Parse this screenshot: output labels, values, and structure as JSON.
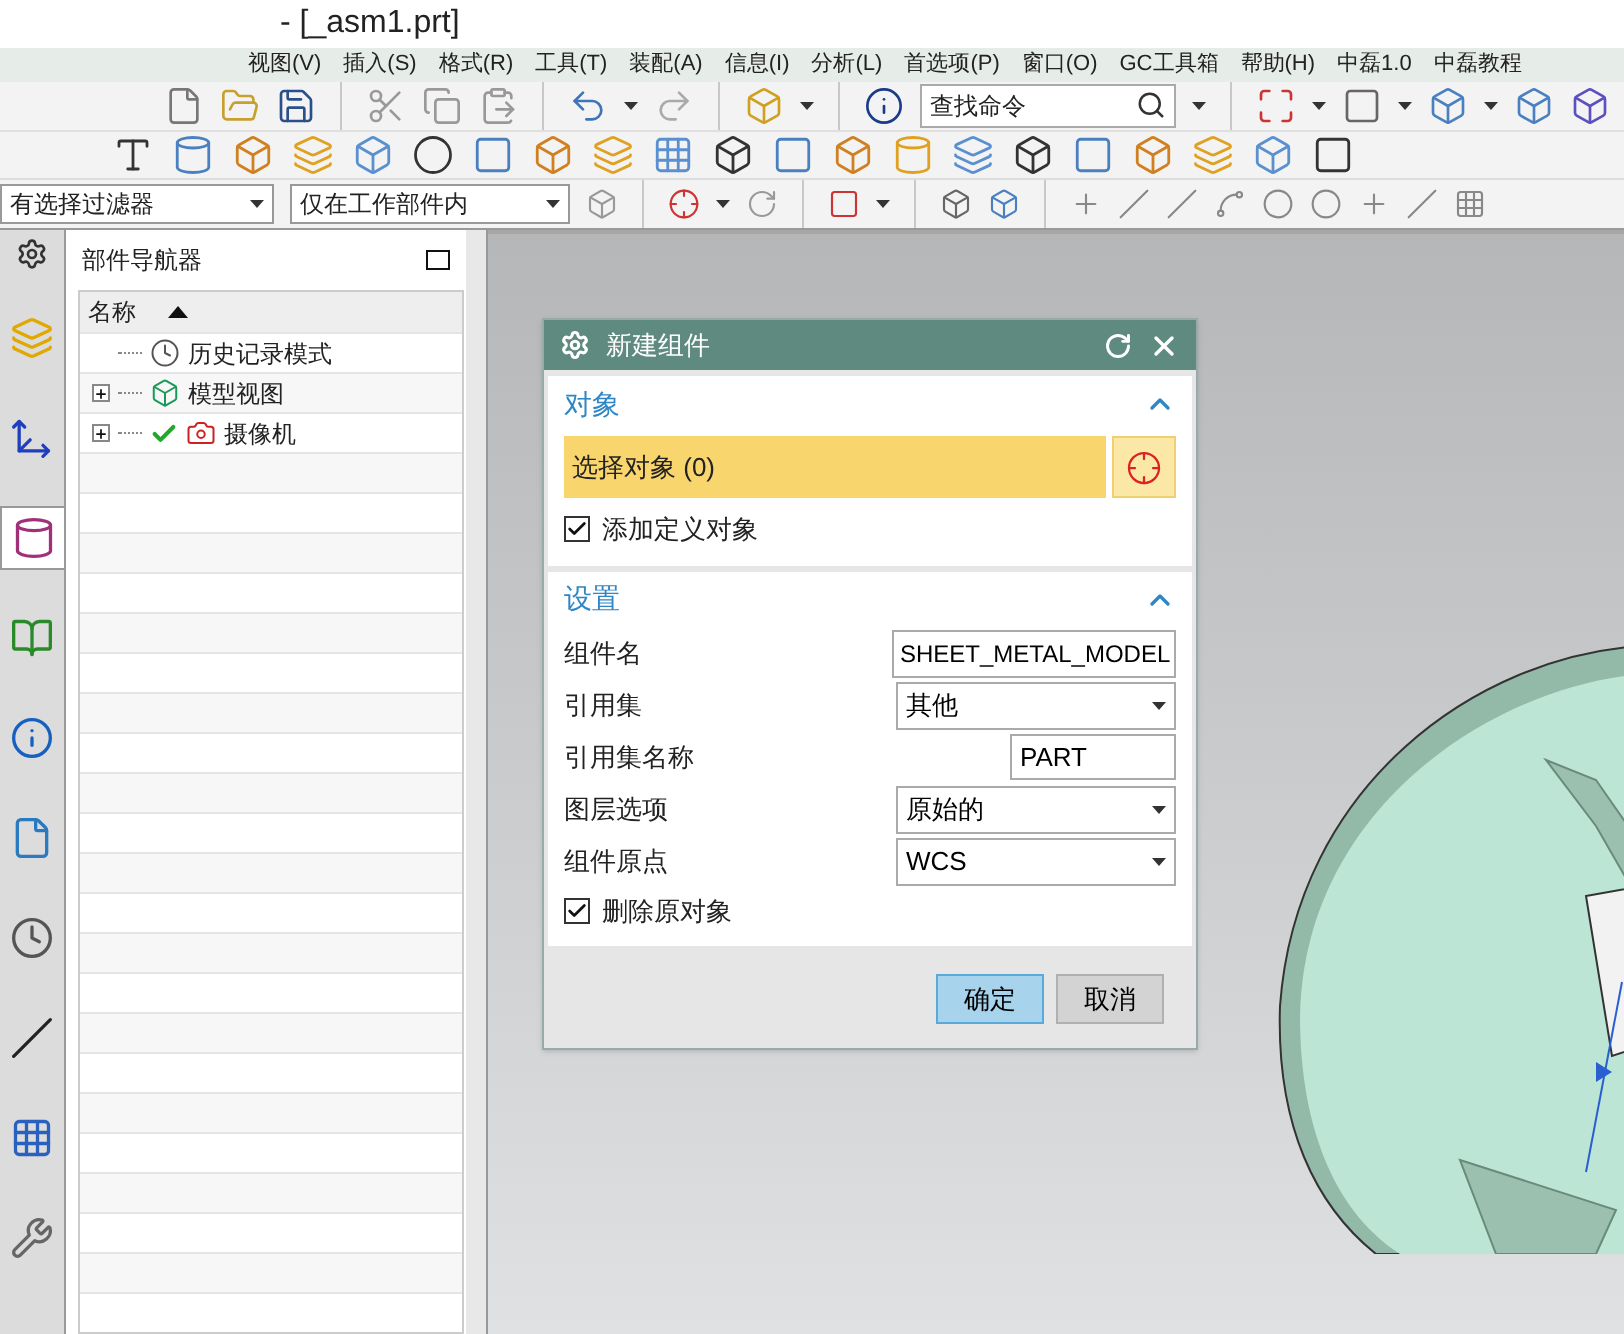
{
  "window": {
    "title": "- [_asm1.prt]"
  },
  "menu": [
    "视图(V)",
    "插入(S)",
    "格式(R)",
    "工具(T)",
    "装配(A)",
    "信息(I)",
    "分析(L)",
    "首选项(P)",
    "窗口(O)",
    "GC工具箱",
    "帮助(H)",
    "中磊1.0",
    "中磊教程"
  ],
  "toolbar": {
    "search": {
      "placeholder": "查找命令"
    }
  },
  "selection_bar": {
    "filter": "有选择过滤器",
    "scope": "仅在工作部件内"
  },
  "side_tabs": [
    {
      "selected": false
    },
    {
      "selected": false
    },
    {
      "selected": true
    },
    {
      "selected": false
    },
    {
      "selected": false
    },
    {
      "selected": false
    },
    {
      "selected": false
    },
    {
      "selected": false
    },
    {
      "selected": false
    },
    {
      "selected": false
    }
  ],
  "navigator": {
    "title": "部件导航器",
    "column": "名称",
    "rows": [
      {
        "label": "历史记录模式",
        "expandable": false,
        "checked": false
      },
      {
        "label": "模型视图",
        "expandable": true,
        "checked": false
      },
      {
        "label": "摄像机",
        "expandable": true,
        "checked": true
      }
    ]
  },
  "dialog": {
    "title": "新建组件",
    "object_section": {
      "title": "对象",
      "expanded": true,
      "select_label": "选择对象 (0)",
      "option": {
        "label": "添加定义对象",
        "checked": true
      }
    },
    "settings_section": {
      "title": "设置",
      "expanded": true,
      "rows": [
        {
          "label": "组件名",
          "kind": "text",
          "value": "SHEET_METAL_MODEL"
        },
        {
          "label": "引用集",
          "kind": "select",
          "value": "其他"
        },
        {
          "label": "引用集名称",
          "kind": "shorttext",
          "value": "PART"
        },
        {
          "label": "图层选项",
          "kind": "select",
          "value": "原始的"
        },
        {
          "label": "组件原点",
          "kind": "select",
          "value": "WCS"
        }
      ],
      "option": {
        "label": "删除原对象",
        "checked": true
      }
    },
    "buttons": [
      {
        "label": "确定",
        "default": true
      },
      {
        "label": "取消",
        "default": false
      }
    ]
  }
}
